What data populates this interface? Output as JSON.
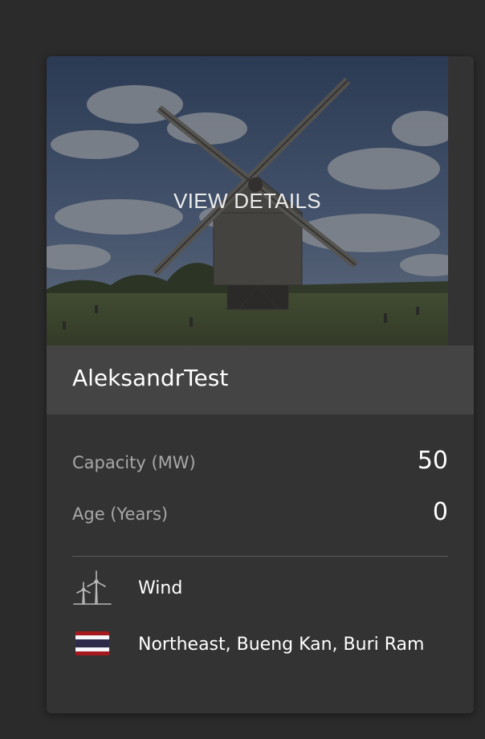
{
  "card": {
    "overlay_label": "VIEW DETAILS",
    "title": "AleksandrTest",
    "stats": [
      {
        "label": "Capacity (MW)",
        "value": "50"
      },
      {
        "label": "Age (Years)",
        "value": "0"
      }
    ],
    "type": {
      "icon": "wind-turbine-icon",
      "label": "Wind"
    },
    "location": {
      "icon": "thailand-flag-icon",
      "label": "Northeast, Bueng Kan, Buri Ram"
    }
  },
  "colors": {
    "page_bg": "#2b2b2b",
    "card_bg": "#333333",
    "title_bar_bg": "#444444",
    "flag_red": "#a5191e",
    "flag_white": "#f4f5f8",
    "flag_blue": "#2d2a4a"
  }
}
